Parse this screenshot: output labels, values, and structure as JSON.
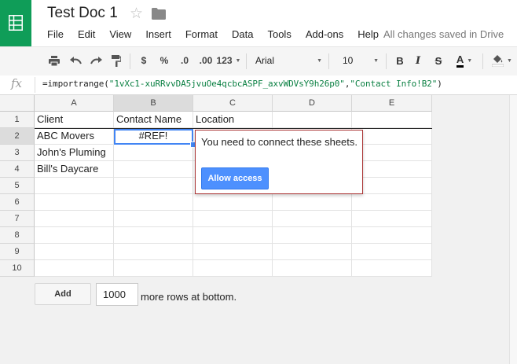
{
  "app": {
    "title": "Test Doc 1",
    "brand_color": "#0f9d58",
    "save_status": "All changes saved in Drive"
  },
  "menu": [
    "File",
    "Edit",
    "View",
    "Insert",
    "Format",
    "Data",
    "Tools",
    "Add-ons",
    "Help"
  ],
  "toolbar": {
    "currency_label": "$",
    "percent_label": "%",
    "decrease_decimal_label": ".0",
    "increase_decimal_label": ".00",
    "more_formats_label": "123",
    "font_family": "Arial",
    "font_size": "10",
    "bold_label": "B",
    "italic_label": "I",
    "strike_label": "S",
    "text_color_label": "A"
  },
  "formula_bar": {
    "fx_label": "fx",
    "formula_prefix": "=importrange(",
    "formula_arg1": "\"1vXc1-xuRRvvDA5jvuOe4qcbcASPF_axvWDVsY9h26p0\"",
    "formula_comma": ",",
    "formula_arg2": "\"Contact Info!B2\"",
    "formula_suffix": ")"
  },
  "sheet": {
    "columns": [
      "A",
      "B",
      "C",
      "D",
      "E"
    ],
    "rows": [
      "1",
      "2",
      "3",
      "4",
      "5",
      "6",
      "7",
      "8",
      "9",
      "10"
    ],
    "cells": {
      "A1": "Client",
      "B1": "Contact Name",
      "C1": "Location",
      "A2": "ABC Movers",
      "B2": "#REF!",
      "A3": "John's Pluming",
      "A4": "Bill's Daycare"
    },
    "selected_cell": "B2",
    "selection_color": "#4285f4"
  },
  "popup": {
    "message": "You need to connect these sheets.",
    "button_label": "Allow access",
    "button_color": "#4d90fe",
    "border_color": "#aa3333"
  },
  "add_rows": {
    "button_label": "Add",
    "count": "1000",
    "suffix": "more rows at bottom."
  }
}
